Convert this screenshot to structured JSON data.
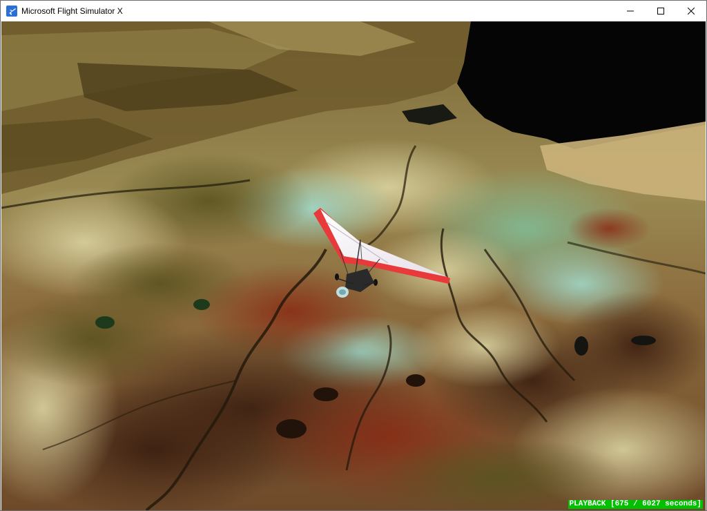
{
  "window": {
    "title": "Microsoft Flight Simulator X",
    "icon": "airplane-icon",
    "controls": {
      "minimize_icon": "minimize-icon",
      "maximize_icon": "maximize-icon",
      "close_icon": "close-icon"
    }
  },
  "viewport": {
    "scene": "ultralight trike over aerial terrain",
    "status_text": "PLAYBACK [675 / 6027 seconds]",
    "status_color": "#00c000"
  },
  "colors": {
    "wing": "#e83a3a",
    "wing_underside": "#f4f0f4",
    "water": "#050505"
  }
}
